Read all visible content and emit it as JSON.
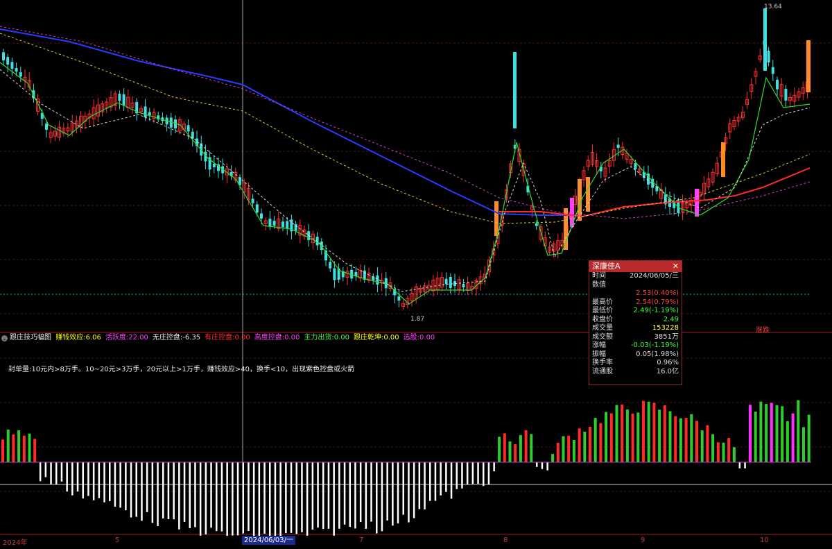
{
  "price_labels": {
    "high": "13.64",
    "low": "1.87"
  },
  "indicator": {
    "name": "跟庄技巧幅图",
    "items": [
      {
        "label": "赚钱效应:",
        "value": "6.06",
        "color": "#ffff00"
      },
      {
        "label": "活跃度:",
        "value": "22.00",
        "color": "#ff40ff"
      },
      {
        "label": "无庄控盘:",
        "value": "-6.35",
        "color": "#e8e8e8"
      },
      {
        "label": "有庄控盘:",
        "value": "0.00",
        "color": "#ff3030"
      },
      {
        "label": "高度控盘:",
        "value": "0.00",
        "color": "#ff40ff"
      },
      {
        "label": "主力出货:",
        "value": "0.00",
        "color": "#40ff40"
      },
      {
        "label": "跟庄乾坤:",
        "value": "0.00",
        "color": "#ffff00"
      },
      {
        "label": "选股:",
        "value": "0.00",
        "color": "#ff40ff"
      }
    ],
    "note": "封单量:10元内>8万手。10~20元>3万手，20元以上>1万手，赚钱效应>40，换手<10，出现紫色控盘或火箭",
    "tag": "涨跌"
  },
  "popup": {
    "title": "深康佳A",
    "rows": [
      {
        "k": "时间",
        "v": "2024/06/05/三",
        "c": "#dcdcdc"
      },
      {
        "k": "数值",
        "v": "",
        "c": "#dcdcdc"
      },
      {
        "k": "",
        "v": "2.53(0.40%)",
        "c": "#ff4040"
      },
      {
        "k": "最高价",
        "v": "2.54(0.79%)",
        "c": "#ff4040"
      },
      {
        "k": "最低价",
        "v": "2.49(-1.19%)",
        "c": "#40ff40"
      },
      {
        "k": "收盘价",
        "v": "2.49",
        "c": "#40ff40"
      },
      {
        "k": "成交量",
        "v": "153228",
        "c": "#ffff40"
      },
      {
        "k": "成交额",
        "v": "3851万",
        "c": "#dcdcdc"
      },
      {
        "k": "涨幅",
        "v": "-0.03(-1.19%)",
        "c": "#40ff40"
      },
      {
        "k": "振幅",
        "v": "0.05(1.98%)",
        "c": "#dcdcdc"
      },
      {
        "k": "换手率",
        "v": "0.96%",
        "c": "#dcdcdc"
      },
      {
        "k": "流通股",
        "v": "16.0亿",
        "c": "#dcdcdc"
      }
    ]
  },
  "time_axis": {
    "year": "2024年",
    "months": [
      "5",
      "7",
      "8",
      "9",
      "10"
    ],
    "cursor_date": "2024/06/03/一"
  },
  "colors": {
    "up": "#ff3030",
    "down": "#40e0e0",
    "panel_up": "#ff2a2a",
    "panel_down": "#2ecc2e",
    "panel_neg": "#ffffff",
    "panel_purple": "#ff30ff",
    "ma_blue": "#2a3aff",
    "ma_red": "#ff2a2a"
  }
}
